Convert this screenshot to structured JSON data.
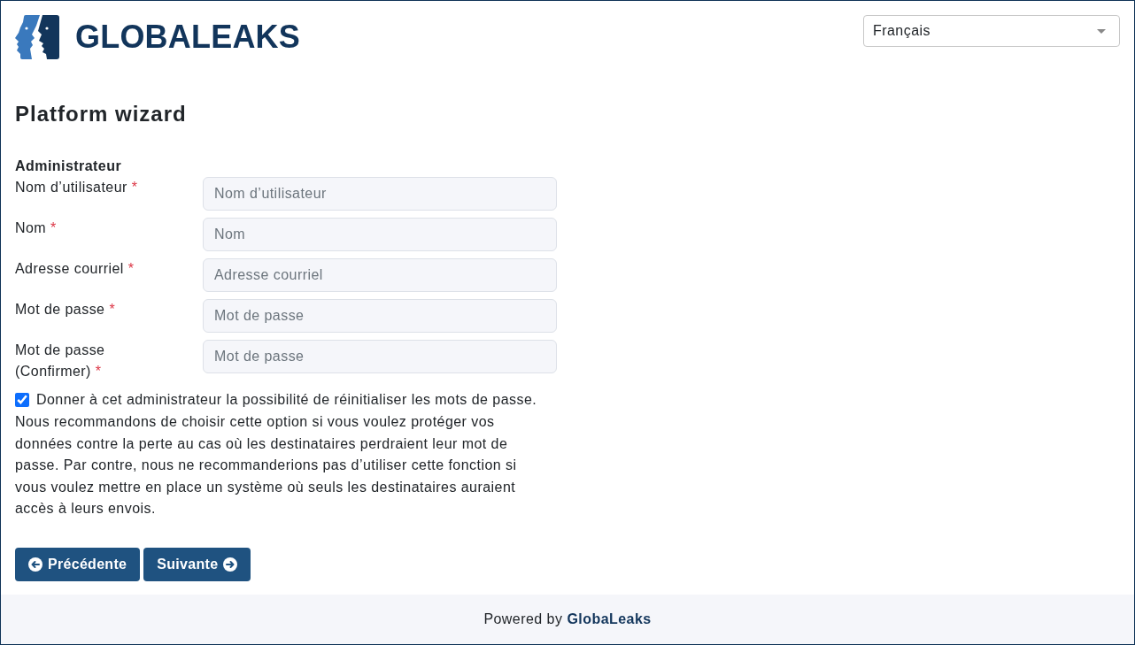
{
  "header": {
    "logo_text": "GLOBALEAKS",
    "language_select": {
      "value": "Français"
    }
  },
  "title": "Platform wizard",
  "section": {
    "title": "Administrateur",
    "fields": [
      {
        "label": "Nom d’utilisateur",
        "required_mark": "*",
        "placeholder": "Nom d’utilisateur"
      },
      {
        "label": "Nom",
        "required_mark": "*",
        "placeholder": "Nom"
      },
      {
        "label": "Adresse courriel",
        "required_mark": "*",
        "placeholder": "Adresse courriel"
      },
      {
        "label": "Mot de passe",
        "required_mark": "*",
        "placeholder": "Mot de passe"
      },
      {
        "label": "Mot de passe (Confirmer)",
        "required_mark": "*",
        "placeholder": "Mot de passe"
      }
    ]
  },
  "reset_option": {
    "checked": true,
    "label": "Donner à cet administrateur la possibilité de réinitialiser les mots de passe."
  },
  "note": "Nous recommandons de choisir cette option si vous voulez protéger vos données contre la perte au cas où les destinataires perdraient leur mot de passe. Par contre, nous ne recommanderions pas d’utiliser cette fonction si vous voulez mettre en place un système où seuls les destinataires auraient accès à leurs envois.",
  "buttons": [
    {
      "label": "Précédente",
      "kind": "back"
    },
    {
      "label": "Suivante",
      "kind": "next"
    }
  ],
  "footer": {
    "text": "Powered by",
    "link": "GlobaLeaks"
  }
}
